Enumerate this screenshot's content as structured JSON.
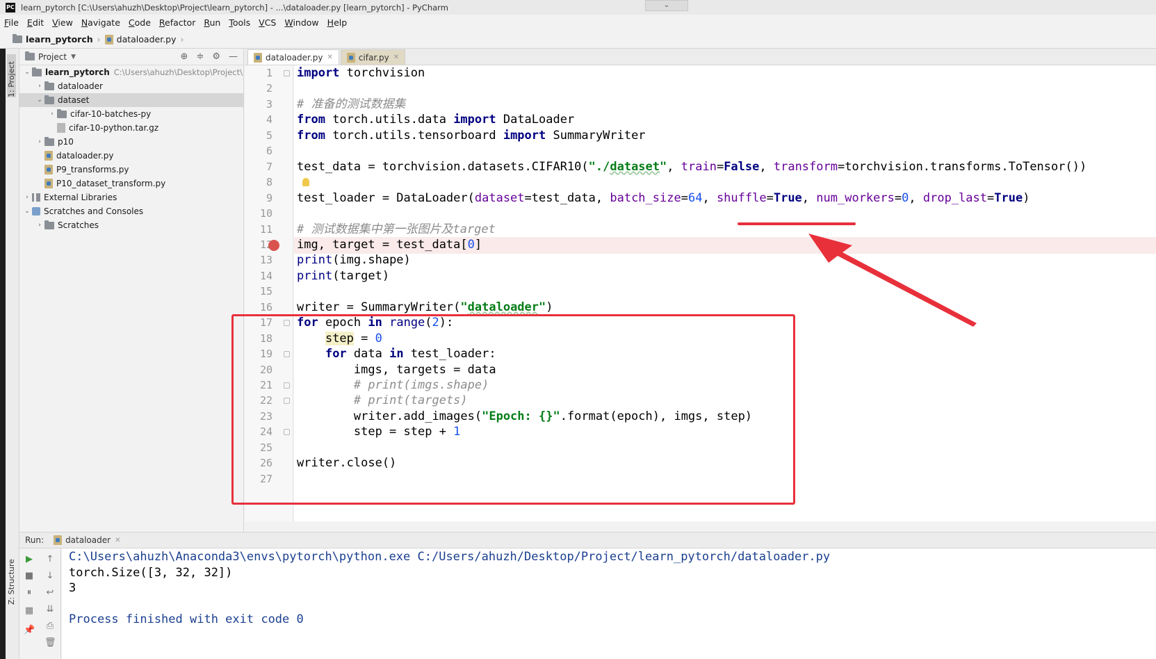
{
  "window": {
    "title": "learn_pytorch [C:\\Users\\ahuzh\\Desktop\\Project\\learn_pytorch] - ...\\dataloader.py [learn_pytorch] - PyCharm",
    "app_icon_text": "PC"
  },
  "menu": [
    "File",
    "Edit",
    "View",
    "Navigate",
    "Code",
    "Refactor",
    "Run",
    "Tools",
    "VCS",
    "Window",
    "Help"
  ],
  "breadcrumb": {
    "project": "learn_pytorch",
    "file": "dataloader.py"
  },
  "project_panel": {
    "title": "Project",
    "tree": [
      {
        "label": "learn_pytorch",
        "path": "C:\\Users\\ahuzh\\Desktop\\Project\\",
        "indent": 0,
        "arrow": "open",
        "icon": "folder-icon",
        "bold": true
      },
      {
        "label": "dataloader",
        "indent": 1,
        "arrow": "closed",
        "icon": "folder-icon"
      },
      {
        "label": "dataset",
        "indent": 1,
        "arrow": "open",
        "icon": "folder-icon",
        "selected": true
      },
      {
        "label": "cifar-10-batches-py",
        "indent": 2,
        "arrow": "closed",
        "icon": "folder-icon"
      },
      {
        "label": "cifar-10-python.tar.gz",
        "indent": 2,
        "arrow": "none",
        "icon": "archive-icon"
      },
      {
        "label": "p10",
        "indent": 1,
        "arrow": "closed",
        "icon": "folder-icon"
      },
      {
        "label": "dataloader.py",
        "indent": 1,
        "arrow": "none",
        "icon": "python-file-icon"
      },
      {
        "label": "P9_transforms.py",
        "indent": 1,
        "arrow": "none",
        "icon": "python-file-icon"
      },
      {
        "label": "P10_dataset_transform.py",
        "indent": 1,
        "arrow": "none",
        "icon": "python-file-icon"
      },
      {
        "label": "External Libraries",
        "indent": 0,
        "arrow": "closed",
        "icon": "library-icon"
      },
      {
        "label": "Scratches and Consoles",
        "indent": 0,
        "arrow": "open",
        "icon": "scratches-icon"
      },
      {
        "label": "Scratches",
        "indent": 1,
        "arrow": "closed",
        "icon": "folder-icon"
      }
    ]
  },
  "side_tabs": {
    "project": "1: Project",
    "structure": "Z: Structure"
  },
  "editor": {
    "tabs": [
      {
        "label": "dataloader.py",
        "active": true
      },
      {
        "label": "cifar.py",
        "active": false
      }
    ],
    "lines": [
      {
        "n": "1",
        "html": "<span class=\"kw\">import</span> torchvision"
      },
      {
        "n": "2",
        "html": ""
      },
      {
        "n": "3",
        "html": "<span class=\"cmt\"># 准备的测试数据集</span>"
      },
      {
        "n": "4",
        "html": "<span class=\"kw\">from</span> torch.utils.data <span class=\"kw\">import</span> DataLoader"
      },
      {
        "n": "5",
        "html": "<span class=\"kw\">from</span> torch.utils.tensorboard <span class=\"kw\">import</span> SummaryWriter"
      },
      {
        "n": "6",
        "html": ""
      },
      {
        "n": "7",
        "html": "test_data = torchvision.datasets.CIFAR10(<span class=\"str\">\"./<span class=\"under\">dataset</span>\"</span>, <span class=\"prm\">train</span>=<span class=\"kw\">False</span>, <span class=\"prm\">transform</span>=torchvision.transforms.ToTensor())"
      },
      {
        "n": "8",
        "html": ""
      },
      {
        "n": "9",
        "html": "test_loader = DataLoader(<span class=\"prm\">dataset</span>=test_data, <span class=\"prm\">batch_size</span>=<span class=\"num\">64</span>, <span class=\"prm\">shuffle</span>=<span class=\"kw\">True</span>, <span class=\"prm\">num_workers</span>=<span class=\"num\">0</span>, <span class=\"prm\">drop_last</span>=<span class=\"kw\">True</span>)"
      },
      {
        "n": "10",
        "html": ""
      },
      {
        "n": "11",
        "html": "<span class=\"cmt\"># 测试数据集中第一张图片及target</span>"
      },
      {
        "n": "12",
        "html": "img, target = test_data[<span class=\"num\">0</span>]",
        "highlight": true,
        "breakpoint": true
      },
      {
        "n": "13",
        "html": "<span class=\"bi\">print</span>(img.shape)"
      },
      {
        "n": "14",
        "html": "<span class=\"bi\">print</span>(target)"
      },
      {
        "n": "15",
        "html": ""
      },
      {
        "n": "16",
        "html": "writer = SummaryWriter(<span class=\"str\">\"<span class=\"under\">dataloader</span>\"</span>)"
      },
      {
        "n": "17",
        "html": "<span class=\"kw\">for</span> epoch <span class=\"kw\">in</span> <span class=\"bi\">range</span>(<span class=\"num\">2</span>):"
      },
      {
        "n": "18",
        "html": "    <span style=\"background:#f5f0c8\">step</span> = <span class=\"num\">0</span>"
      },
      {
        "n": "19",
        "html": "    <span class=\"kw\">for</span> data <span class=\"kw\">in</span> test_loader:"
      },
      {
        "n": "20",
        "html": "        imgs, targets = data"
      },
      {
        "n": "21",
        "html": "        <span class=\"cmt\"># print(imgs.shape)</span>"
      },
      {
        "n": "22",
        "html": "        <span class=\"cmt\"># print(targets)</span>"
      },
      {
        "n": "23",
        "html": "        writer.add_images(<span class=\"str\">\"Epoch: {}\"</span>.format(epoch), imgs, step)"
      },
      {
        "n": "24",
        "html": "        step = step + <span class=\"num\">1</span>"
      },
      {
        "n": "25",
        "html": ""
      },
      {
        "n": "26",
        "html": "writer.close()"
      },
      {
        "n": "27",
        "html": ""
      }
    ]
  },
  "run_panel": {
    "label": "Run:",
    "tab": "dataloader",
    "console": [
      {
        "text": "C:\\Users\\ahuzh\\Anaconda3\\envs\\pytorch\\python.exe C:/Users/ahuzh/Desktop/Project/learn_pytorch/dataloader.py",
        "kind": "cmd"
      },
      {
        "text": "torch.Size([3, 32, 32])",
        "kind": "out"
      },
      {
        "text": "3",
        "kind": "out"
      },
      {
        "text": "",
        "kind": "out"
      },
      {
        "text": "Process finished with exit code 0",
        "kind": "fin"
      }
    ]
  },
  "annotations": {
    "highlight_color": "#e8303b"
  }
}
